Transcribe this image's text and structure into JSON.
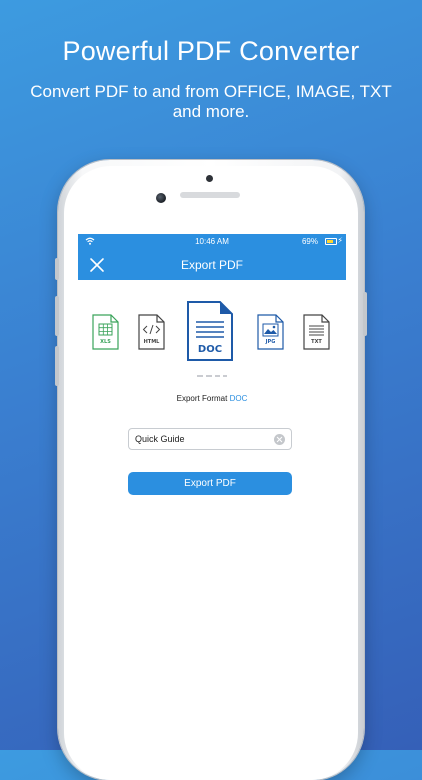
{
  "promo": {
    "headline": "Powerful PDF Converter",
    "subline": "Convert PDF to and from OFFICE, IMAGE, TXT and more."
  },
  "status_bar": {
    "time": "10:46 AM",
    "battery": "69%",
    "battery_level": 0.69
  },
  "nav": {
    "title": "Export PDF",
    "close_icon": "close-icon"
  },
  "formats": [
    {
      "label": "XLS",
      "icon": "spreadsheet-grid-icon",
      "color": "#3aa35a"
    },
    {
      "label": "HTML",
      "icon": "code-brackets-icon",
      "color": "#444444"
    },
    {
      "label": "DOC",
      "icon": "text-lines-icon",
      "color": "#1e5aa8",
      "selected": true
    },
    {
      "label": "JPG",
      "icon": "image-icon",
      "color": "#1e5aa8"
    },
    {
      "label": "TXT",
      "icon": "text-lines-icon",
      "color": "#444444"
    }
  ],
  "export_format": {
    "label": "Export Format",
    "value": "DOC"
  },
  "filename_field": {
    "value": "Quick Guide"
  },
  "export_button": {
    "label": "Export PDF"
  },
  "colors": {
    "accent": "#2b8fe0",
    "background_top": "#3d9be0",
    "background_bottom": "#3560b8"
  }
}
